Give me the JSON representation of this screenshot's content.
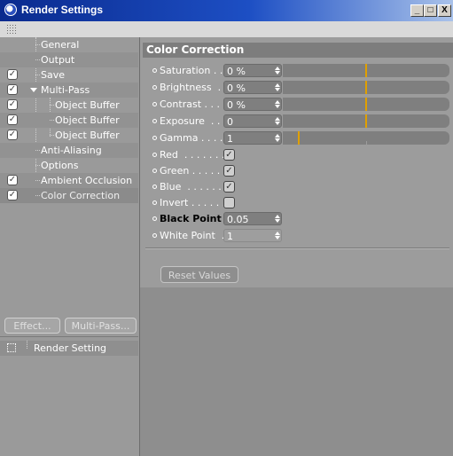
{
  "window": {
    "title": "Render Settings",
    "minimize": "_",
    "maximize": "□",
    "close": "X"
  },
  "tree": {
    "items": [
      {
        "label": "General",
        "checked": false
      },
      {
        "label": "Output",
        "checked": false
      },
      {
        "label": "Save",
        "checked": true
      },
      {
        "label": "Multi-Pass",
        "checked": true,
        "expanded": true
      },
      {
        "label": "Object Buffer",
        "checked": true
      },
      {
        "label": "Object Buffer",
        "checked": true
      },
      {
        "label": "Object Buffer",
        "checked": true
      },
      {
        "label": "Anti-Aliasing",
        "checked": false
      },
      {
        "label": "Options",
        "checked": false
      },
      {
        "label": "Ambient Occlusion",
        "checked": true
      },
      {
        "label": "Color Correction",
        "checked": true,
        "selected": true
      }
    ],
    "check_glyph": "✓",
    "effect_button": "Effect...",
    "multipass_button": "Multi-Pass...",
    "render_setting_item": "Render Setting"
  },
  "panel": {
    "header": "Color Correction",
    "params": [
      {
        "label": "Saturation . . .",
        "value": "0 %",
        "slider": 0.5
      },
      {
        "label": "Brightness  . .",
        "value": "0 %",
        "slider": 0.5
      },
      {
        "label": "Contrast . . . .",
        "value": "0 %",
        "slider": 0.5
      },
      {
        "label": "Exposure  . . .",
        "value": "0",
        "slider": 0.5
      },
      {
        "label": "Gamma . . . . .",
        "value": "1",
        "slider": 0.1
      }
    ],
    "checks": [
      {
        "label": "Red  . . . . . . .",
        "checked": true
      },
      {
        "label": "Green . . . . . .",
        "checked": true
      },
      {
        "label": "Blue  . . . . . . .",
        "checked": true
      },
      {
        "label": "Invert . . . . . .",
        "checked": false
      }
    ],
    "black_point": {
      "label": "Black Point",
      "value": "0.05"
    },
    "white_point": {
      "label": "White Point  .",
      "value": "1"
    },
    "reset_button": "Reset Values"
  },
  "colors": {
    "accent": "#e0a000",
    "title_bar": "#0a2a8e"
  }
}
